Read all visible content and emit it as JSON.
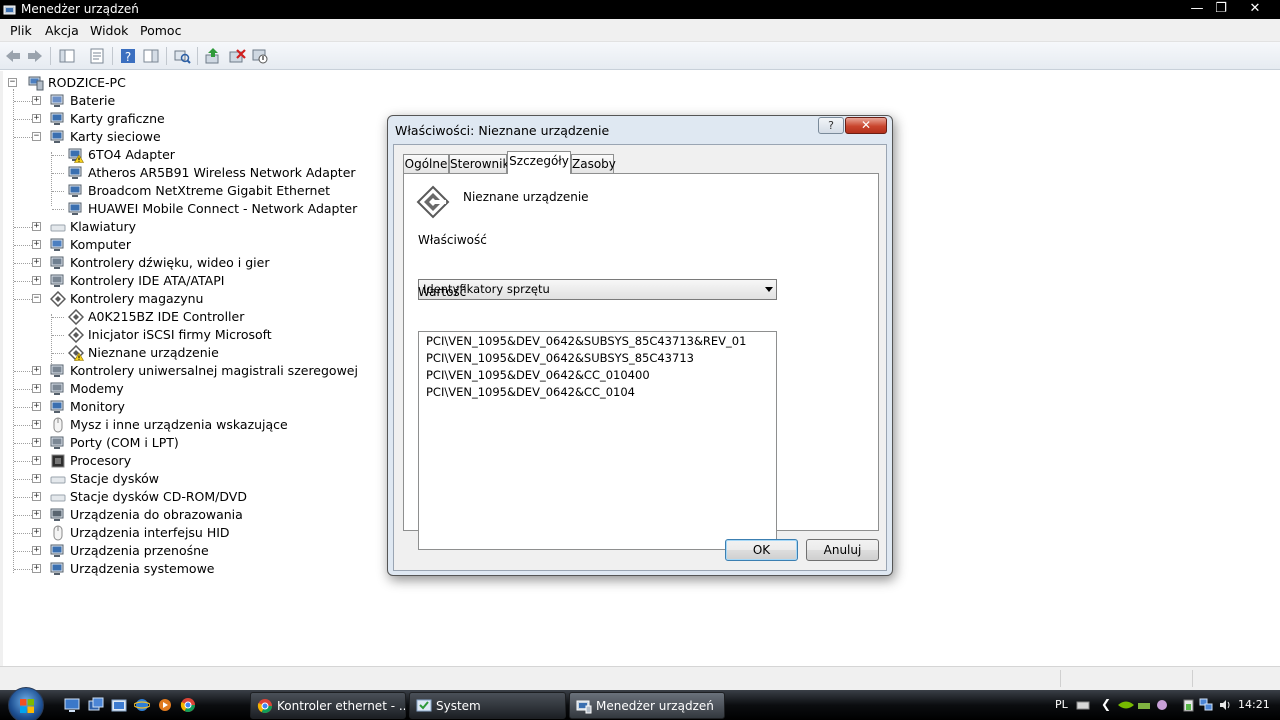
{
  "window": {
    "title": "Menedżer urządzeń"
  },
  "menu": [
    "Plik",
    "Akcja",
    "Widok",
    "Pomoc"
  ],
  "tree": {
    "root": "RODZICE-PC",
    "nodes": [
      {
        "label": "Baterie",
        "level": 1,
        "state": "collapsed",
        "icon": "battery-icon"
      },
      {
        "label": "Karty graficzne",
        "level": 1,
        "state": "collapsed",
        "icon": "display-adapter-icon"
      },
      {
        "label": "Karty sieciowe",
        "level": 1,
        "state": "expanded",
        "icon": "network-adapter-icon"
      },
      {
        "label": "6TO4 Adapter",
        "level": 2,
        "state": "leaf",
        "icon": "network-warning-icon"
      },
      {
        "label": "Atheros AR5B91 Wireless Network Adapter",
        "level": 2,
        "state": "leaf",
        "icon": "network-adapter-icon"
      },
      {
        "label": "Broadcom NetXtreme Gigabit Ethernet",
        "level": 2,
        "state": "leaf",
        "icon": "network-adapter-icon"
      },
      {
        "label": "HUAWEI Mobile Connect - Network Adapter",
        "level": 2,
        "state": "leaf",
        "icon": "network-adapter-icon"
      },
      {
        "label": "Klawiatury",
        "level": 1,
        "state": "collapsed",
        "icon": "keyboard-icon"
      },
      {
        "label": "Komputer",
        "level": 1,
        "state": "collapsed",
        "icon": "computer-icon"
      },
      {
        "label": "Kontrolery dźwięku, wideo i gier",
        "level": 1,
        "state": "collapsed",
        "icon": "sound-icon"
      },
      {
        "label": "Kontrolery IDE ATA/ATAPI",
        "level": 1,
        "state": "collapsed",
        "icon": "ide-icon"
      },
      {
        "label": "Kontrolery magazynu",
        "level": 1,
        "state": "expanded",
        "icon": "storage-controller-icon"
      },
      {
        "label": "A0K215BZ IDE Controller",
        "level": 2,
        "state": "leaf",
        "icon": "storage-controller-icon"
      },
      {
        "label": "Inicjator iSCSI firmy Microsoft",
        "level": 2,
        "state": "leaf",
        "icon": "storage-controller-icon"
      },
      {
        "label": "Nieznane urządzenie",
        "level": 2,
        "state": "leaf",
        "icon": "unknown-device-warning-icon"
      },
      {
        "label": "Kontrolery uniwersalnej magistrali szeregowej",
        "level": 1,
        "state": "collapsed",
        "icon": "usb-icon"
      },
      {
        "label": "Modemy",
        "level": 1,
        "state": "collapsed",
        "icon": "modem-icon"
      },
      {
        "label": "Monitory",
        "level": 1,
        "state": "collapsed",
        "icon": "monitor-icon"
      },
      {
        "label": "Mysz i inne urządzenia wskazujące",
        "level": 1,
        "state": "collapsed",
        "icon": "mouse-icon"
      },
      {
        "label": "Porty (COM i LPT)",
        "level": 1,
        "state": "collapsed",
        "icon": "port-icon"
      },
      {
        "label": "Procesory",
        "level": 1,
        "state": "collapsed",
        "icon": "processor-icon"
      },
      {
        "label": "Stacje dysków",
        "level": 1,
        "state": "collapsed",
        "icon": "disk-drive-icon"
      },
      {
        "label": "Stacje dysków CD-ROM/DVD",
        "level": 1,
        "state": "collapsed",
        "icon": "cdrom-icon"
      },
      {
        "label": "Urządzenia do obrazowania",
        "level": 1,
        "state": "collapsed",
        "icon": "imaging-icon"
      },
      {
        "label": "Urządzenia interfejsu HID",
        "level": 1,
        "state": "collapsed",
        "icon": "hid-icon"
      },
      {
        "label": "Urządzenia przenośne",
        "level": 1,
        "state": "collapsed",
        "icon": "portable-device-icon"
      },
      {
        "label": "Urządzenia systemowe",
        "level": 1,
        "state": "collapsed",
        "icon": "system-device-icon"
      }
    ]
  },
  "dialog": {
    "title": "Właściwości: Nieznane urządzenie",
    "help_label": "?",
    "tabs": [
      "Ogólne",
      "Sterownik",
      "Szczegóły",
      "Zasoby"
    ],
    "active_tab": "Szczegóły",
    "device_name": "Nieznane urządzenie",
    "property_label": "Właściwość",
    "property_value": "Identyfikatory sprzętu",
    "value_label": "Wartość",
    "values": [
      "PCI\\VEN_1095&DEV_0642&SUBSYS_85C43713&REV_01",
      "PCI\\VEN_1095&DEV_0642&SUBSYS_85C43713",
      "PCI\\VEN_1095&DEV_0642&CC_010400",
      "PCI\\VEN_1095&DEV_0642&CC_0104"
    ],
    "ok_label": "OK",
    "cancel_label": "Anuluj"
  },
  "taskbar": {
    "tasks": [
      {
        "label": "Kontroler ethernet - ...",
        "icon": "chrome-icon",
        "active": false
      },
      {
        "label": "System",
        "icon": "system-icon",
        "active": false
      },
      {
        "label": "Menedżer urządzeń",
        "icon": "device-manager-icon",
        "active": true
      }
    ],
    "language": "PL",
    "clock": "14:21"
  }
}
